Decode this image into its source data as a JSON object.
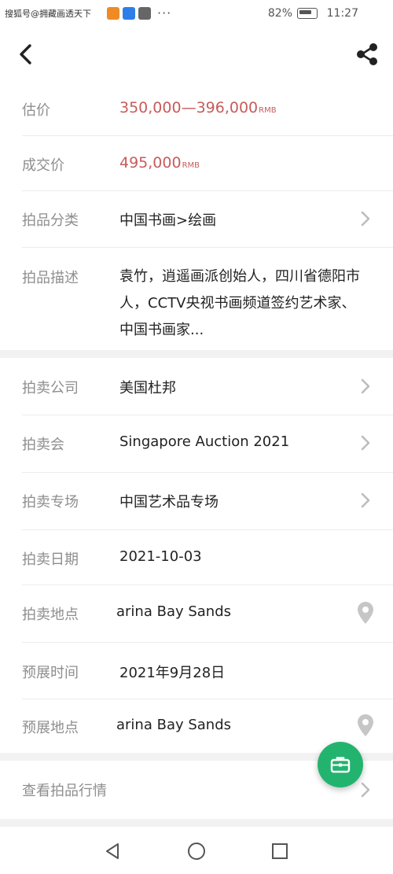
{
  "status_bar": {
    "carrier_text": "搜狐号@拥藏画透天下",
    "battery": "82%",
    "time": "11:27"
  },
  "header": {
    "back_icon": "chevron-left-icon",
    "share_icon": "share-icon"
  },
  "lot": {
    "estimate_label": "估价",
    "estimate_value": "350,000—396,000",
    "estimate_unit": "RMB",
    "sold_label": "成交价",
    "sold_value": "495,000",
    "sold_unit": "RMB",
    "category_label": "拍品分类",
    "category_value": "中国书画>绘画",
    "description_label": "拍品描述",
    "description_value": "袁竹，逍遥画派创始人，四川省德阳市人，CCTV央视书画频道签约艺术家、中国书画家..."
  },
  "auction": {
    "company_label": "拍卖公司",
    "company_value": "美国杜邦",
    "sale_label": "拍卖会",
    "sale_value": "Singapore Auction 2021",
    "session_label": "拍卖专场",
    "session_value": "中国艺术品专场",
    "date_label": "拍卖日期",
    "date_value": "2021-10-03",
    "location_label": "拍卖地点",
    "location_value": "arina Bay Sands",
    "preview_time_label": "预展时间",
    "preview_time_value": "2021年9月28日",
    "preview_location_label": "预展地点",
    "preview_location_value": "arina Bay Sands"
  },
  "market": {
    "label": "查看拍品行情"
  },
  "colors": {
    "accent_green": "#22b46e",
    "price_red": "#c85b5b"
  }
}
